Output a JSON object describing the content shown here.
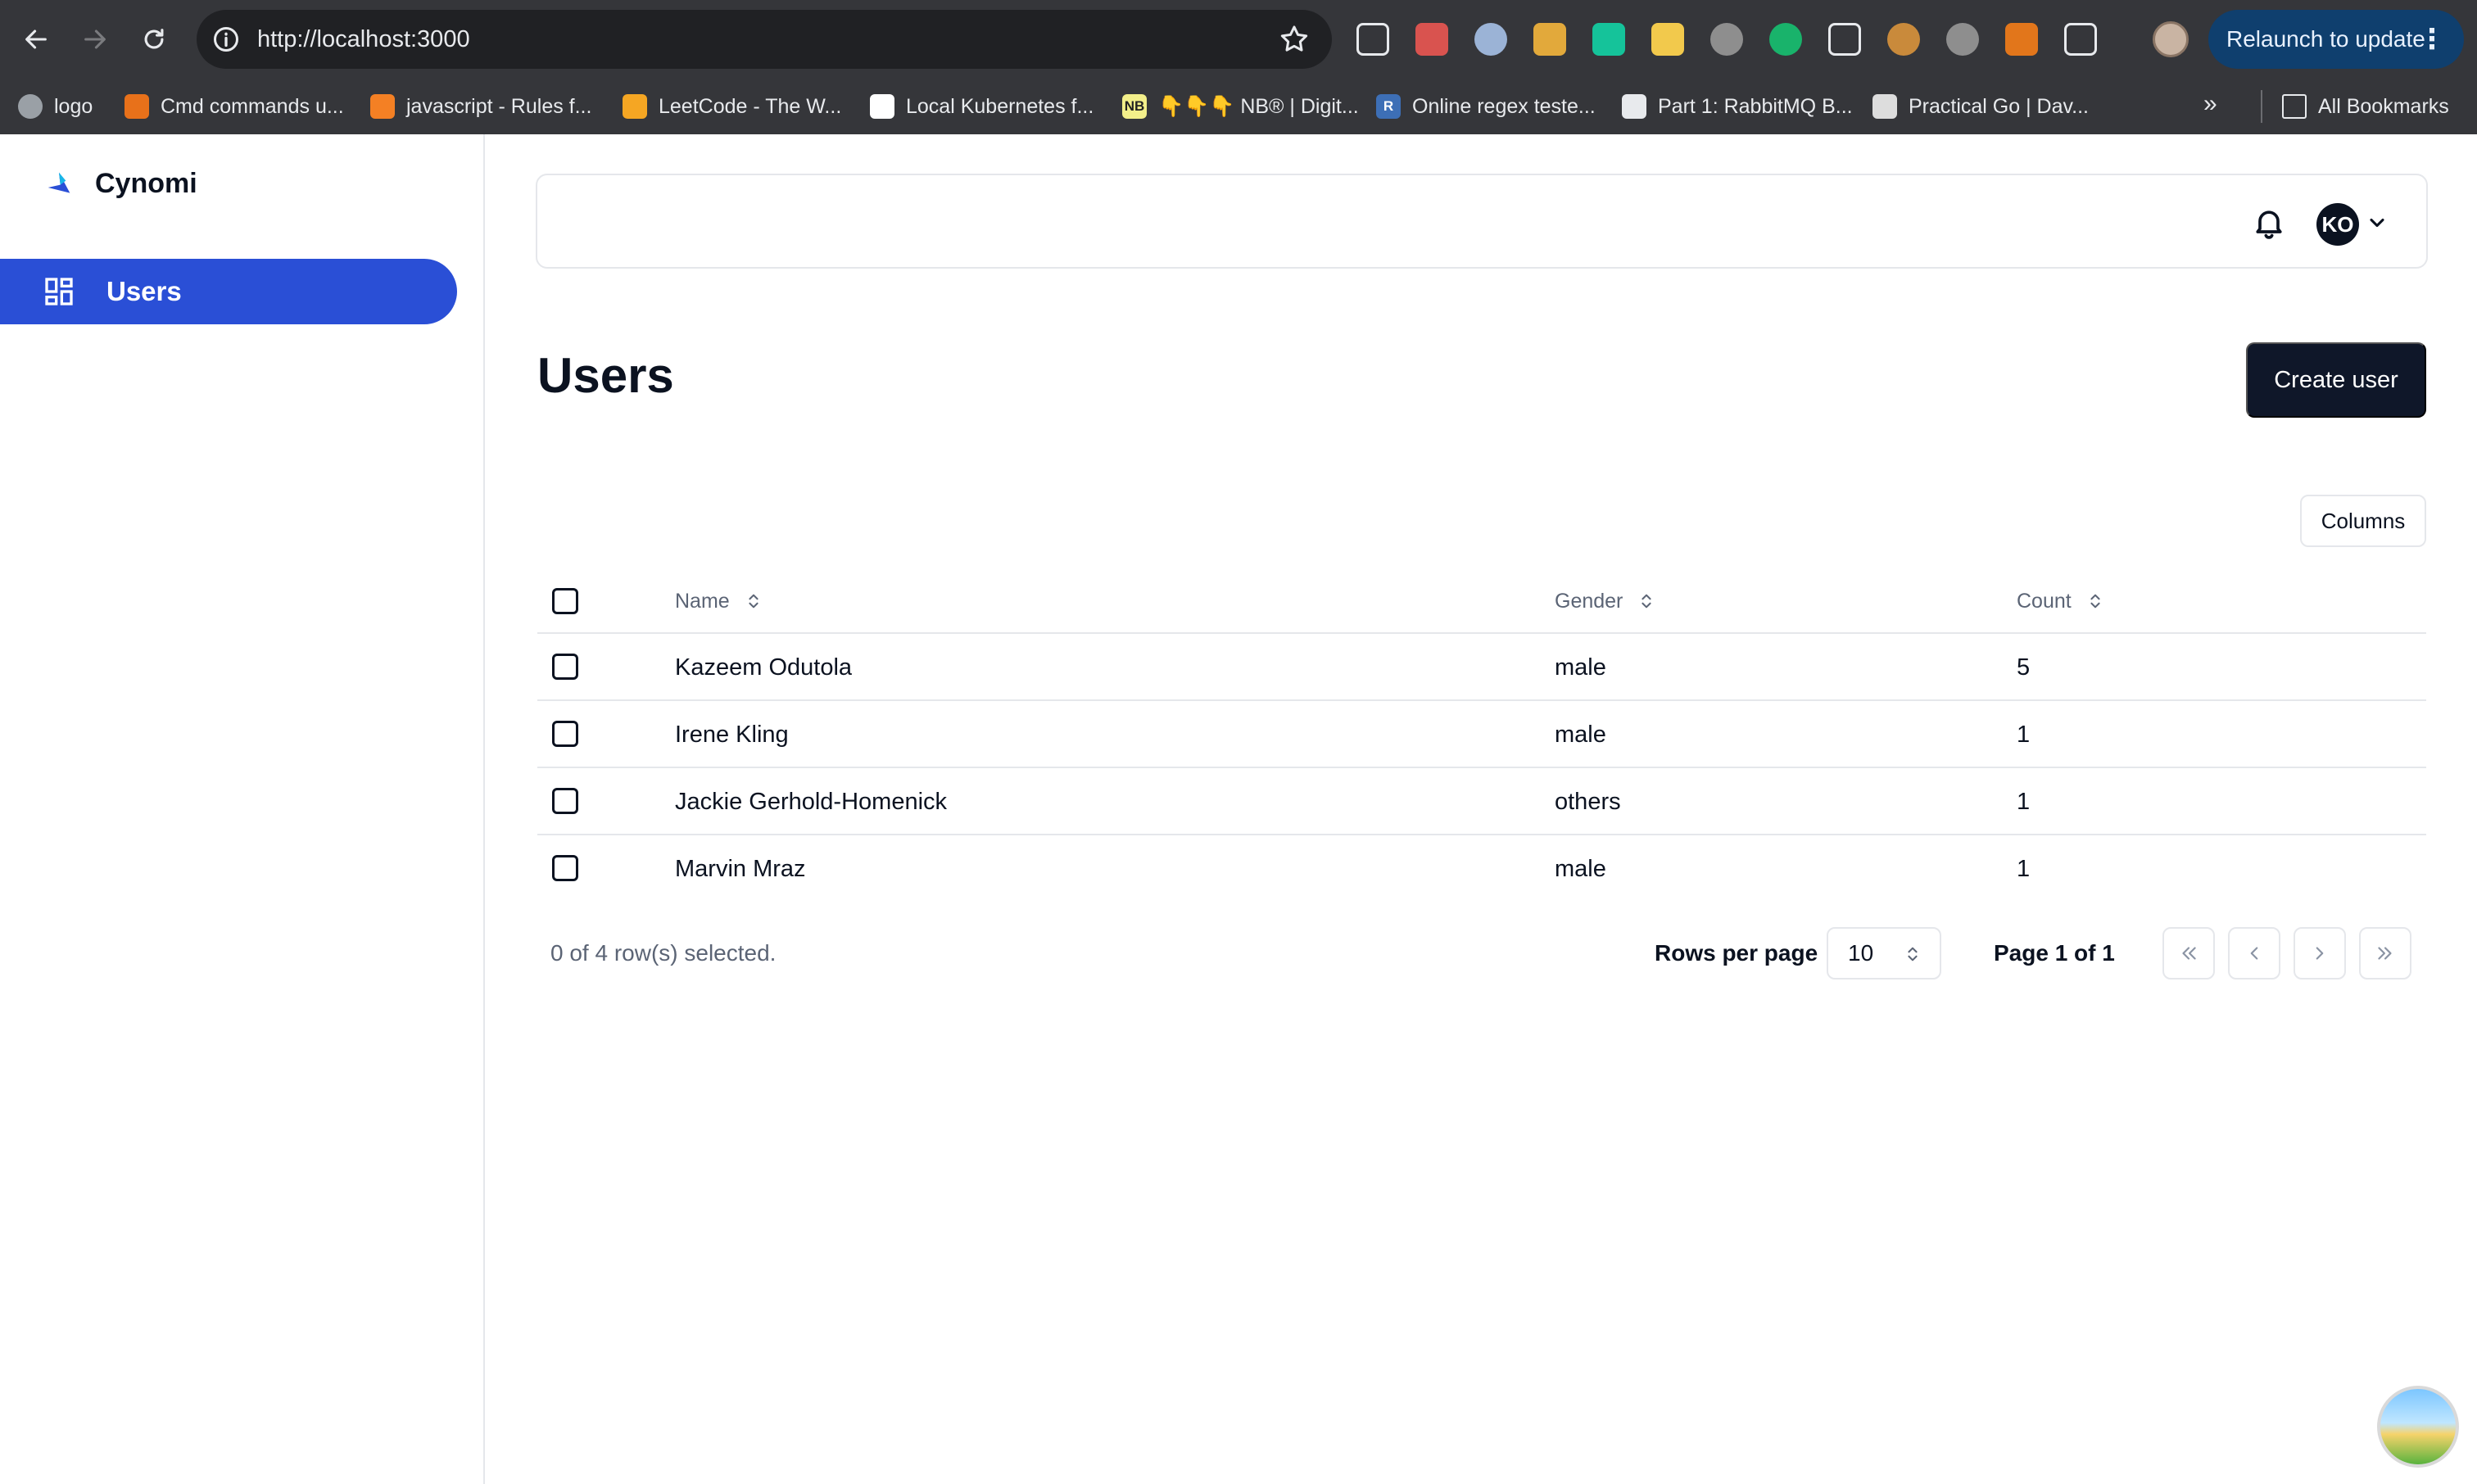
{
  "browser": {
    "url": "http://localhost:3000",
    "relaunch_label": "Relaunch to update",
    "relaunch_dots": "⋮",
    "more_bookmarks": "»",
    "bookmarks": [
      {
        "label": "logo",
        "icon": "globe-icon",
        "color": "#9aa0a6",
        "glyph": ""
      },
      {
        "label": "Cmd commands u...",
        "icon": "stack-icon",
        "color": "#e8711a",
        "glyph": ""
      },
      {
        "label": "javascript - Rules f...",
        "icon": "stackoverflow-icon",
        "color": "#f48024",
        "glyph": ""
      },
      {
        "label": "LeetCode - The W...",
        "icon": "leetcode-icon",
        "color": "#f5a623",
        "glyph": ""
      },
      {
        "label": "Local Kubernetes f...",
        "icon": "medium-icon",
        "color": "#ffffff",
        "glyph": ""
      },
      {
        "label": "👇👇👇 NB® | Digit...",
        "icon": "nb-icon",
        "color": "#f3ef8a",
        "glyph": "NB"
      },
      {
        "label": "Online regex teste...",
        "icon": "regex-icon",
        "color": "#3d6fb6",
        "glyph": "R"
      },
      {
        "label": "Part 1: RabbitMQ B...",
        "icon": "rabbit-icon",
        "color": "#e8eaed",
        "glyph": ""
      },
      {
        "label": "Practical Go | Dav...",
        "icon": "gopher-icon",
        "color": "#dddddd",
        "glyph": ""
      },
      {
        "label": "All Bookmarks",
        "icon": "folder-icon",
        "color": "#35363a",
        "glyph": ""
      }
    ],
    "extensions": [
      {
        "icon": "cube-icon",
        "color": "#35363a"
      },
      {
        "icon": "gift-icon",
        "color": "#d9534f"
      },
      {
        "icon": "circle-icon",
        "color": "#9bb3d6"
      },
      {
        "icon": "palette-icon",
        "color": "#e2a93b"
      },
      {
        "icon": "grammarly-icon",
        "color": "#15c39a"
      },
      {
        "icon": "lock-icon",
        "color": "#f2c94c"
      },
      {
        "icon": "chart-icon",
        "color": "#8e8e8e"
      },
      {
        "icon": "target-icon",
        "color": "#19b36b"
      },
      {
        "icon": "leaf-icon",
        "color": "#35363a"
      },
      {
        "icon": "cookie-icon",
        "color": "#c98a3b"
      },
      {
        "icon": "compass-icon",
        "color": "#8e8e8e"
      },
      {
        "icon": "fox-icon",
        "color": "#e2761b"
      },
      {
        "icon": "puzzle-icon",
        "color": "#35363a"
      }
    ]
  },
  "app": {
    "brand": "Cynomi",
    "accent": "#2a4fd6",
    "nav": [
      {
        "label": "Users",
        "icon": "dashboard-grid-icon"
      }
    ],
    "avatar_initials": "KO",
    "page_title": "Users",
    "create_button": "Create user",
    "columns_button": "Columns"
  },
  "table": {
    "headers": [
      "Name",
      "Gender",
      "Count"
    ],
    "rows": [
      {
        "name": "Kazeem Odutola",
        "gender": "male",
        "count": "5"
      },
      {
        "name": "Irene Kling",
        "gender": "male",
        "count": "1"
      },
      {
        "name": "Jackie Gerhold-Homenick",
        "gender": "others",
        "count": "1"
      },
      {
        "name": "Marvin Mraz",
        "gender": "male",
        "count": "1"
      }
    ]
  },
  "footer": {
    "selected_text": "0 of 4 row(s) selected.",
    "rows_per_page_label": "Rows per page",
    "rows_per_page_value": "10",
    "page_info": "Page 1 of 1"
  }
}
